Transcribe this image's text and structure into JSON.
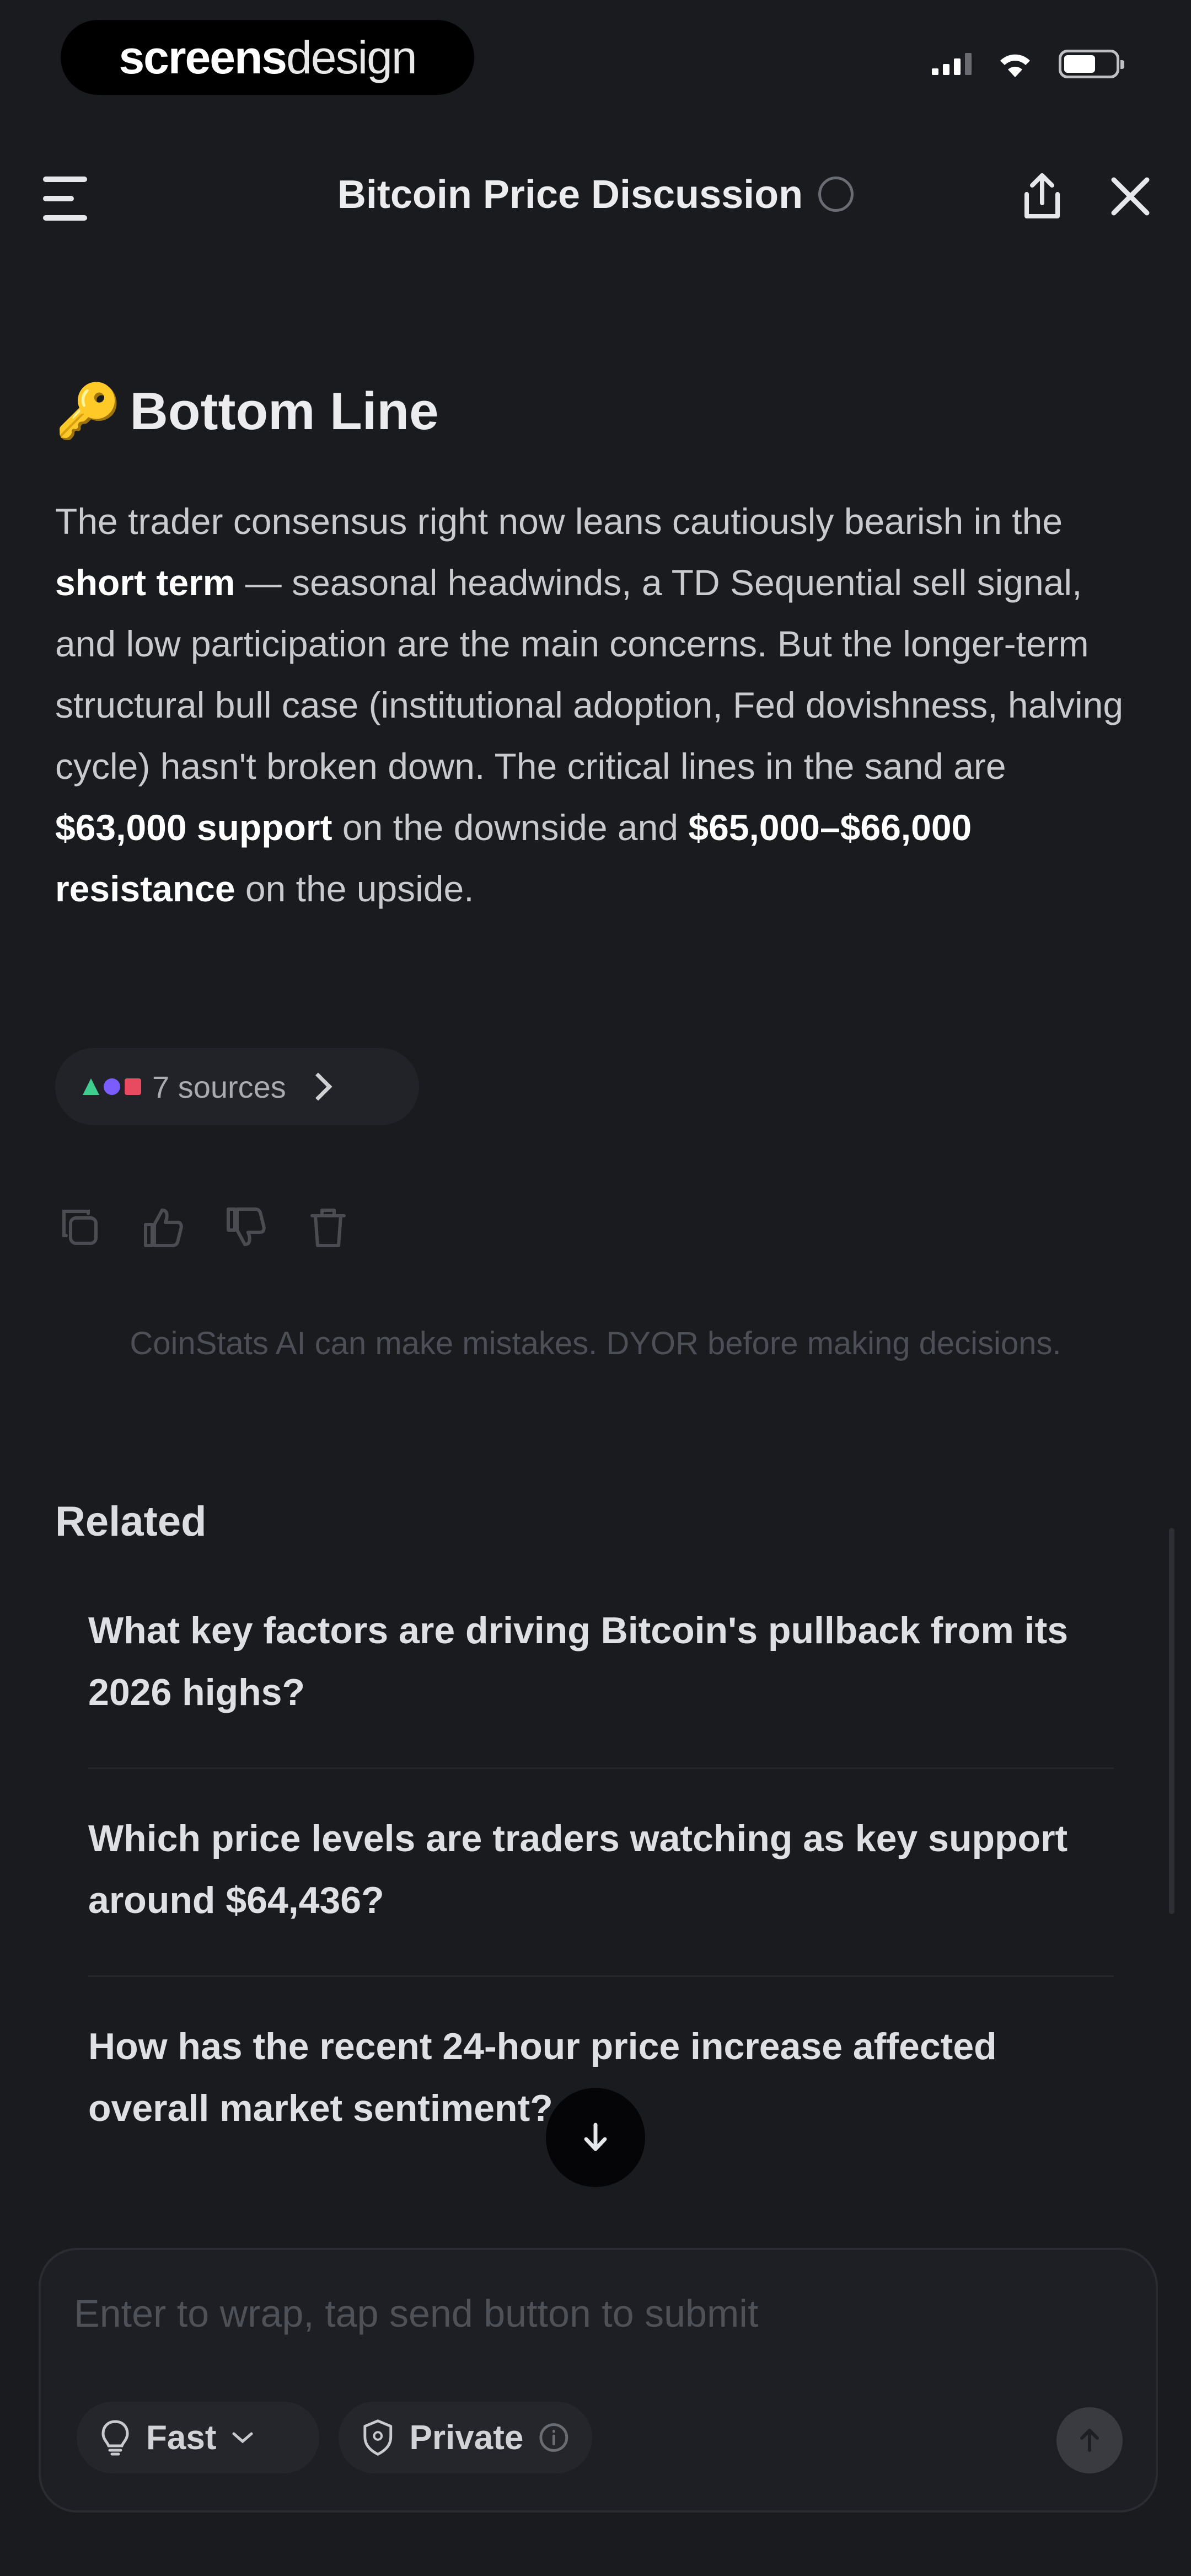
{
  "status_bar": {
    "brand_bold": "screens",
    "brand_light": "design"
  },
  "header": {
    "title": "Bitcoin Price Discussion"
  },
  "answer": {
    "section_emoji": "🔑",
    "section_title": "Bottom Line",
    "p1": "The trader consensus right now leans cautiously bearish in the ",
    "b1": "short term",
    "p2": " — seasonal headwinds, a TD Sequential sell signal, and low participation are the main concerns. But the longer-term structural bull case (institutional adoption, Fed dovishness, halving cycle) hasn't broken down. The critical lines in the sand are ",
    "b2": "$63,000 support",
    "p3": " on the downside and ",
    "b3": "$65,000–$66,000 resistance",
    "p4": " on the upside."
  },
  "sources": {
    "label": "7 sources",
    "icon_colors": [
      "#3ecf8e",
      "#7b5cff",
      "#e84a5f"
    ]
  },
  "disclaimer": "CoinStats AI can make mistakes. DYOR before making decisions.",
  "related": {
    "title": "Related",
    "items": [
      "What key factors are driving Bitcoin's pullback from its 2026 highs?",
      "Which price levels are traders watching as key support around $64,436?",
      "How has the recent 24-hour price increase affected overall market sentiment?"
    ]
  },
  "composer": {
    "placeholder": "Enter to wrap, tap send button to submit",
    "mode_label": "Fast",
    "privacy_label": "Private"
  },
  "colors": {
    "background": "#1a1b1f",
    "key_emoji": "#e8b43a"
  }
}
